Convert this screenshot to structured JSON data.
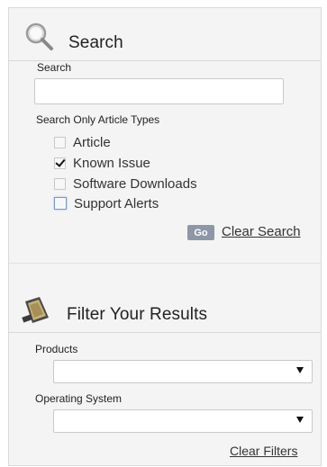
{
  "search": {
    "title": "Search",
    "field_label": "Search",
    "value": "",
    "placeholder": "",
    "types_label": "Search Only Article Types",
    "types": [
      {
        "label": "Article",
        "checked": false
      },
      {
        "label": "Known Issue",
        "checked": true
      },
      {
        "label": "Software Downloads",
        "checked": false
      },
      {
        "label": "Support Alerts",
        "checked": false
      }
    ],
    "go_label": "Go",
    "clear_label": "Clear Search"
  },
  "filter": {
    "title": "Filter Your Results",
    "products_label": "Products",
    "products_value": "",
    "os_label": "Operating System",
    "os_value": "",
    "clear_label": "Clear Filters"
  }
}
